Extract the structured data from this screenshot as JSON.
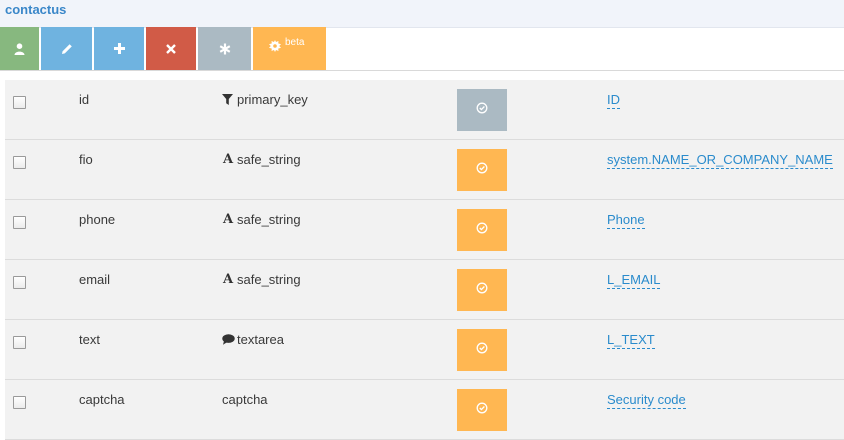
{
  "header": {
    "title": "contactus"
  },
  "toolbar": {
    "beta_label": "beta",
    "buttons": [
      {
        "icon": "user-icon",
        "color": "#87b87f"
      },
      {
        "icon": "pencil-icon",
        "color": "#6fb3e0"
      },
      {
        "icon": "plus-icon",
        "color": "#6fb3e0"
      },
      {
        "icon": "close-icon",
        "color": "#d15b47"
      },
      {
        "icon": "asterisk-icon",
        "color": "#abbac3"
      },
      {
        "icon": "gear-icon",
        "color": "#ffb752"
      }
    ]
  },
  "fields": [
    {
      "name": "id",
      "type": "primary_key",
      "type_icon": "filter-icon",
      "status_color": "#abbac3",
      "label": "ID"
    },
    {
      "name": "fio",
      "type": "safe_string",
      "type_icon": "font-icon",
      "status_color": "#ffb752",
      "label": "system.NAME_OR_COMPANY_NAME"
    },
    {
      "name": "phone",
      "type": "safe_string",
      "type_icon": "font-icon",
      "status_color": "#ffb752",
      "label": "Phone"
    },
    {
      "name": "email",
      "type": "safe_string",
      "type_icon": "font-icon",
      "status_color": "#ffb752",
      "label": "L_EMAIL"
    },
    {
      "name": "text",
      "type": "textarea",
      "type_icon": "comment-icon",
      "status_color": "#ffb752",
      "label": "L_TEXT"
    },
    {
      "name": "captcha",
      "type": "captcha",
      "type_icon": "",
      "status_color": "#ffb752",
      "label": "Security code"
    }
  ]
}
